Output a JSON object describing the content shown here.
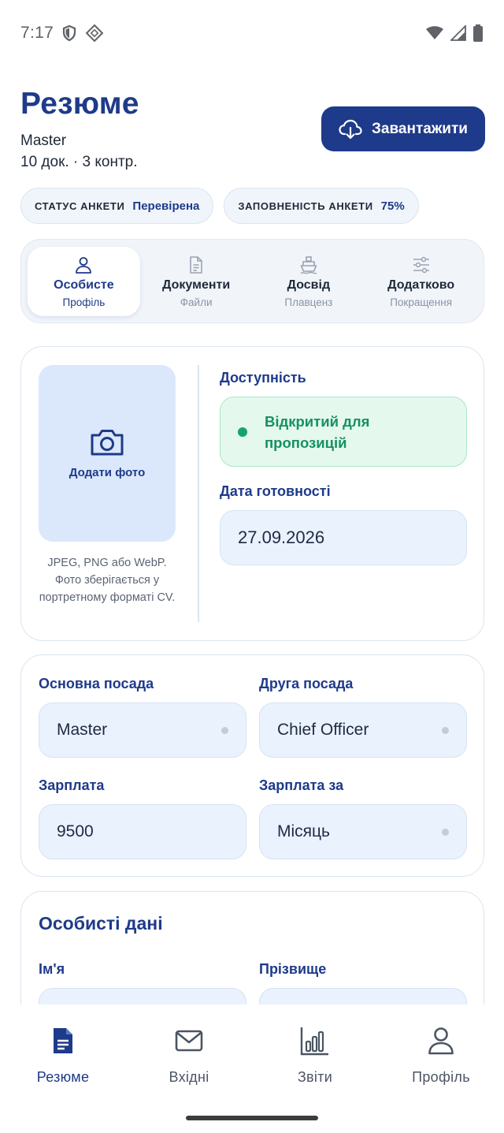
{
  "status_bar": {
    "time": "7:17",
    "icons": [
      "shield-icon",
      "location-diamond-icon",
      "wifi-icon",
      "signal-icon",
      "battery-icon"
    ]
  },
  "header": {
    "title": "Резюме",
    "rank": "Master",
    "summary": "10 док. · 3 контр.",
    "download_label": "Завантажити"
  },
  "chips": [
    {
      "label": "СТАТУС АНКЕТИ",
      "value": "Перевірена"
    },
    {
      "label": "ЗАПОВНЕНІСТЬ АНКЕТИ",
      "value": "75%"
    }
  ],
  "tabs": [
    {
      "label": "Особисте",
      "sub": "Профіль",
      "icon": "person-icon",
      "active": true
    },
    {
      "label": "Документи",
      "sub": "Файли",
      "icon": "document-icon",
      "active": false
    },
    {
      "label": "Досвід",
      "sub": "Плавценз",
      "icon": "ship-icon",
      "active": false
    },
    {
      "label": "Додатково",
      "sub": "Покращення",
      "icon": "sliders-icon",
      "active": false
    }
  ],
  "profile_card": {
    "photo_label": "Додати фото",
    "photo_hint": "JPEG, PNG або WebP. Фото зберігається у портретному форматі CV.",
    "availability_label": "Доступність",
    "availability_status": "Відкритий для пропозицій",
    "ready_date_label": "Дата готовності",
    "ready_date_value": "27.09.2026"
  },
  "position_card": {
    "main_position_label": "Основна посада",
    "main_position_value": "Master",
    "second_position_label": "Друга посада",
    "second_position_value": "Chief Officer",
    "salary_label": "Зарплата",
    "salary_value": "9500",
    "salary_period_label": "Зарплата за",
    "salary_period_value": "Місяць"
  },
  "personal_card": {
    "title": "Особисті дані",
    "first_name_label": "Ім'я",
    "last_name_label": "Прізвище"
  },
  "colors": {
    "brand": "#1e3a8a",
    "available": "#16a36b",
    "input_bg": "#eaf2fd"
  },
  "bottom_nav": [
    {
      "label": "Резюме",
      "icon": "resume-icon",
      "active": true
    },
    {
      "label": "Вхідні",
      "icon": "mail-icon",
      "active": false
    },
    {
      "label": "Звіти",
      "icon": "bar-chart-icon",
      "active": false
    },
    {
      "label": "Профіль",
      "icon": "profile-icon",
      "active": false
    }
  ]
}
